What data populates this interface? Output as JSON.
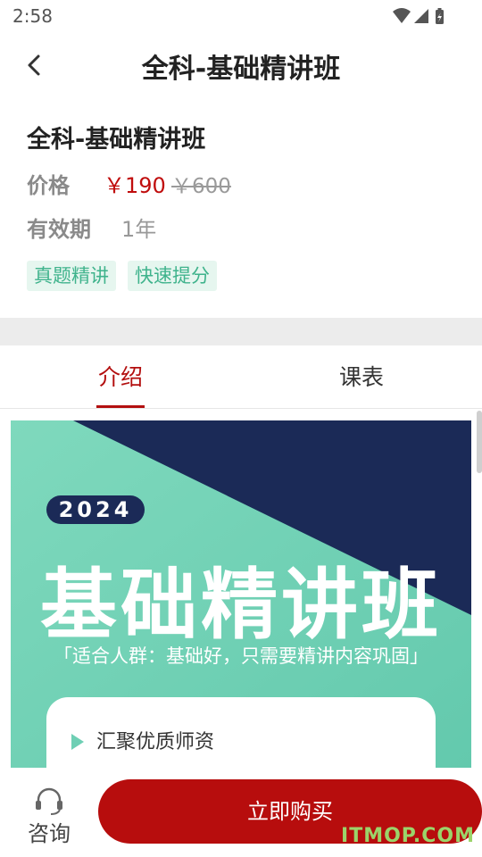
{
  "status": {
    "time": "2:58"
  },
  "header": {
    "title": "全科-基础精讲班"
  },
  "course": {
    "name": "全科-基础精讲班",
    "price_label": "价格",
    "price": "￥190",
    "original_price": "￥600",
    "validity_label": "有效期",
    "validity": "1年",
    "tags": [
      "真题精讲",
      "快速提分"
    ]
  },
  "tabs": [
    {
      "label": "介绍",
      "active": true
    },
    {
      "label": "课表",
      "active": false
    }
  ],
  "banner": {
    "year": "2024",
    "title": "基础精讲班",
    "subtitle": "「适合人群：基础好，只需要精讲内容巩固」",
    "features": [
      "汇聚优质师资"
    ],
    "colors": {
      "mint": "#6ed1b6",
      "navy": "#1b2a57"
    }
  },
  "bottom": {
    "consult_label": "咨询",
    "buy_label": "立即购买"
  },
  "watermark": "ITMOP.COM",
  "colors": {
    "accent_red": "#b70d0d",
    "tag_green": "#3fb38c"
  }
}
